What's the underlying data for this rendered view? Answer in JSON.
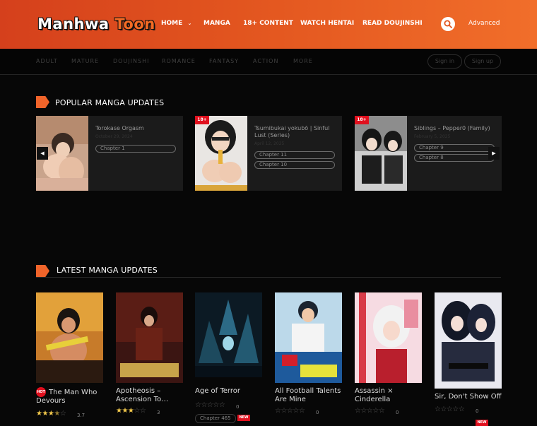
{
  "header": {
    "logo_part1": "Manhwa",
    "logo_part2": "Toon",
    "nav": [
      {
        "label": "HOME"
      },
      {
        "label": "MANGA"
      },
      {
        "label": "18+ CONTENT"
      },
      {
        "label": "WATCH HENTAI"
      },
      {
        "label": "READ DOUJINSHI"
      }
    ],
    "advanced_label": "Advanced"
  },
  "subnav": {
    "genres": [
      "ADULT",
      "MATURE",
      "DOUJINSHI",
      "ROMANCE",
      "FANTASY",
      "ACTION",
      "MORE"
    ],
    "signin_label": "Sign in",
    "signup_label": "Sign up"
  },
  "popular": {
    "title": "POPULAR MANGA UPDATES",
    "items": [
      {
        "title": "Torokase Orgasm",
        "date": "October 29, 2024",
        "badge": "",
        "chapters": [
          "Chapter 1"
        ]
      },
      {
        "title": "Tsumibukai yokubō | Sinful Lust (Series)",
        "date": "April 12, 2025",
        "badge": "18+",
        "chapters": [
          "Chapter 11",
          "Chapter 10"
        ]
      },
      {
        "title": "Siblings – Pepper0 (Family)",
        "date": "February 5, 2025",
        "badge": "18+",
        "chapters": [
          "Chapter 9",
          "Chapter 8"
        ]
      }
    ]
  },
  "latest": {
    "title": "LATEST MANGA UPDATES",
    "items": [
      {
        "title": "The Man Who Devours",
        "hot": "HOT",
        "rating": 3.7,
        "rating_text": "3.7",
        "chapter": "",
        "new": ""
      },
      {
        "title": "Apotheosis – Ascension To…",
        "hot": "",
        "rating": 3,
        "rating_text": "3",
        "chapter": "",
        "new": ""
      },
      {
        "title": "Age of Terror",
        "hot": "",
        "rating": 0,
        "rating_text": "0",
        "chapter": "Chapter 465",
        "new": "NEW"
      },
      {
        "title": "All Football Talents Are Mine",
        "hot": "",
        "rating": 0,
        "rating_text": "0",
        "chapter": "",
        "new": ""
      },
      {
        "title": "Assassin × Cinderella",
        "hot": "",
        "rating": 0,
        "rating_text": "0",
        "chapter": "",
        "new": ""
      },
      {
        "title": "Sir, Don't Show Off",
        "hot": "",
        "rating": 0,
        "rating_text": "0",
        "chapter": "",
        "new": "NEW"
      }
    ]
  },
  "colors": {
    "accent": "#f0642a",
    "badge_red": "#e0101e",
    "star": "#f2c84b"
  }
}
